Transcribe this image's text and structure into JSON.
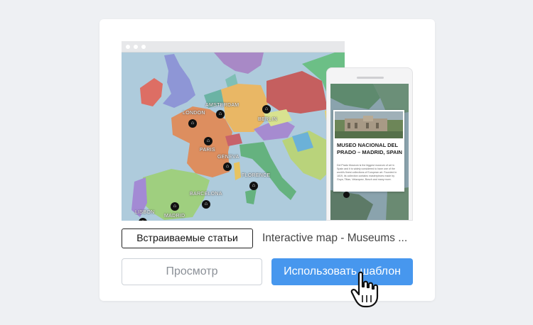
{
  "template_card": {
    "category_tag": "Встраиваемые статьи",
    "template_title": "Interactive map - Museums ...",
    "preview_button": "Просмотр",
    "use_template_button": "Использовать шаблон"
  },
  "map": {
    "cities": [
      "AMSTERDAM",
      "LONDON",
      "BERLIN",
      "PARIS",
      "GENEVA",
      "FLORENCE",
      "BARCELONA",
      "MADRID",
      "LISBON"
    ],
    "pin_icon": "museum-icon"
  },
  "phone_popup": {
    "title": "MUSEO NACIONAL DEL PRADO – MADRID, SPAIN",
    "description": "Del Prado Museum is the biggest museum of art in Spain and it is widely considered to have one of the world's finest collections of European art. Founded in 1819, its collection contains masterpieces made by Goya, Titian, Velazquez, Bosch and many more."
  },
  "colors": {
    "primary_button": "#4797ee",
    "sea": "#aecbdc"
  },
  "cursor_icon": "hand-pointer-icon"
}
